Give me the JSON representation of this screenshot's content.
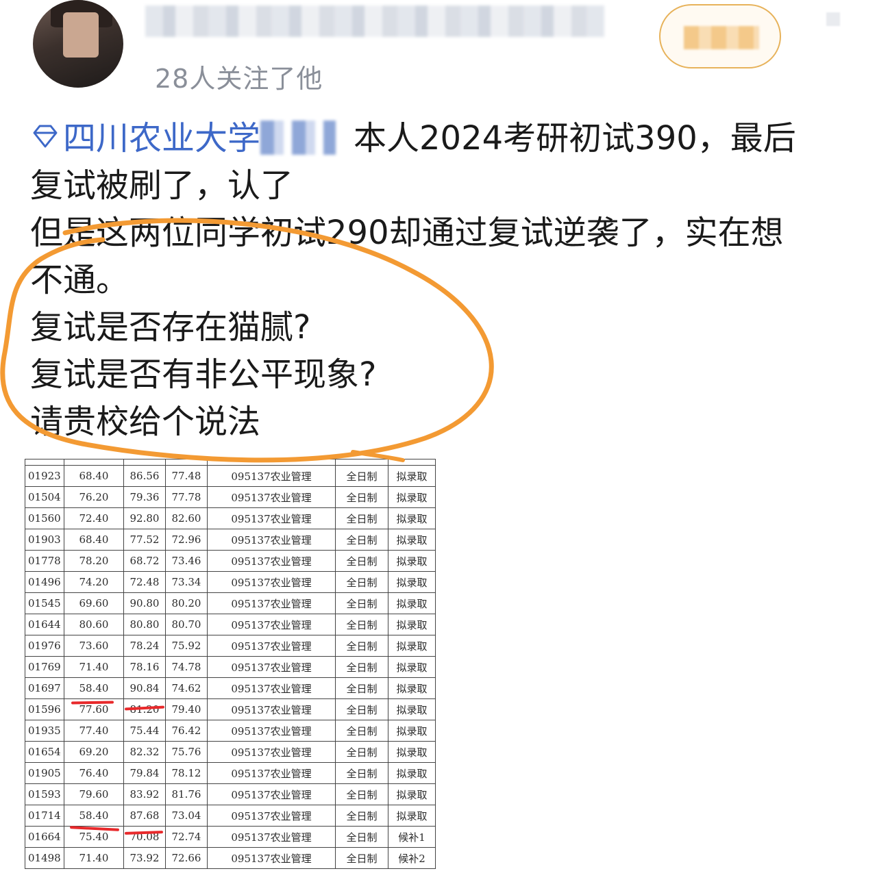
{
  "header": {
    "follow_count": "28人关注了他"
  },
  "post": {
    "topic_label": "四川农业大学",
    "line1_rest": "本人2024考研初试390，最后",
    "line2": "复试被刷了，认了",
    "line3": "但是这两位同学初试290却通过复试逆袭了，实在想",
    "line4": "不通。",
    "line5": "复试是否存在猫腻?",
    "line6": "复试是否有非公平现象?",
    "line7": "请贵校给个说法"
  },
  "colors": {
    "topic": "#3d68c8",
    "circle": "#f39a33",
    "underline": "#e8292b"
  },
  "table": {
    "rows": [
      [
        "01923",
        "68.40",
        "86.56",
        "77.48",
        "095137农业管理",
        "全日制",
        "拟录取"
      ],
      [
        "01504",
        "76.20",
        "79.36",
        "77.78",
        "095137农业管理",
        "全日制",
        "拟录取"
      ],
      [
        "01560",
        "72.40",
        "92.80",
        "82.60",
        "095137农业管理",
        "全日制",
        "拟录取"
      ],
      [
        "01903",
        "68.40",
        "77.52",
        "72.96",
        "095137农业管理",
        "全日制",
        "拟录取"
      ],
      [
        "01778",
        "78.20",
        "68.72",
        "73.46",
        "095137农业管理",
        "全日制",
        "拟录取"
      ],
      [
        "01496",
        "74.20",
        "72.48",
        "73.34",
        "095137农业管理",
        "全日制",
        "拟录取"
      ],
      [
        "01545",
        "69.60",
        "90.80",
        "80.20",
        "095137农业管理",
        "全日制",
        "拟录取"
      ],
      [
        "01644",
        "80.60",
        "80.80",
        "80.70",
        "095137农业管理",
        "全日制",
        "拟录取"
      ],
      [
        "01976",
        "73.60",
        "78.24",
        "75.92",
        "095137农业管理",
        "全日制",
        "拟录取"
      ],
      [
        "01769",
        "71.40",
        "78.16",
        "74.78",
        "095137农业管理",
        "全日制",
        "拟录取"
      ],
      [
        "01697",
        "58.40",
        "90.84",
        "74.62",
        "095137农业管理",
        "全日制",
        "拟录取"
      ],
      [
        "01596",
        "77.60",
        "81.20",
        "79.40",
        "095137农业管理",
        "全日制",
        "拟录取"
      ],
      [
        "01935",
        "77.40",
        "75.44",
        "76.42",
        "095137农业管理",
        "全日制",
        "拟录取"
      ],
      [
        "01654",
        "69.20",
        "82.32",
        "75.76",
        "095137农业管理",
        "全日制",
        "拟录取"
      ],
      [
        "01905",
        "76.40",
        "79.84",
        "78.12",
        "095137农业管理",
        "全日制",
        "拟录取"
      ],
      [
        "01593",
        "79.60",
        "83.92",
        "81.76",
        "095137农业管理",
        "全日制",
        "拟录取"
      ],
      [
        "01714",
        "58.40",
        "87.68",
        "73.04",
        "095137农业管理",
        "全日制",
        "拟录取"
      ],
      [
        "01664",
        "75.40",
        "70.08",
        "72.74",
        "095137农业管理",
        "全日制",
        "候补1"
      ],
      [
        "01498",
        "71.40",
        "73.92",
        "72.66",
        "095137农业管理",
        "全日制",
        "候补2"
      ]
    ]
  }
}
